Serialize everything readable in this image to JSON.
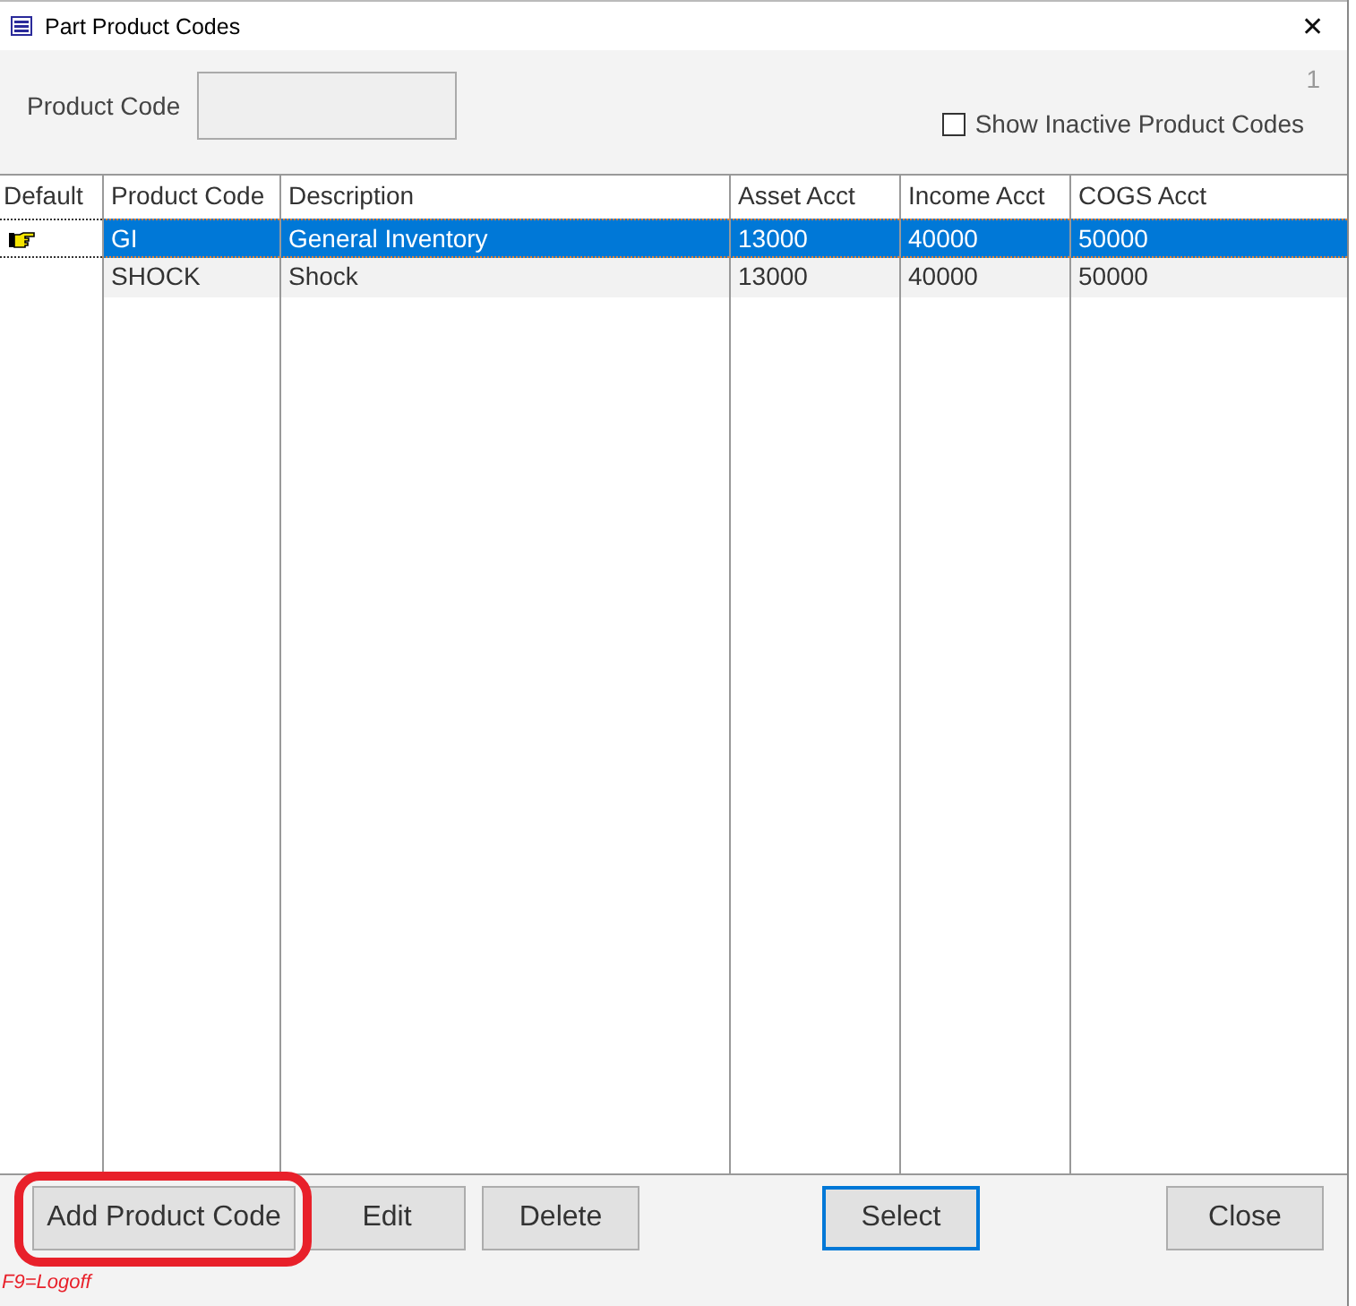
{
  "window": {
    "title": "Part Product Codes",
    "close": "✕"
  },
  "record_count": "1",
  "product_code": {
    "label": "Product Code"
  },
  "show_inactive": {
    "label": "Show Inactive Product Codes",
    "checked": false
  },
  "table": {
    "columns": [
      "Default",
      "Product Code",
      "Description",
      "Asset  Acct",
      "Income Acct",
      "COGS Acct"
    ],
    "rows": [
      {
        "default": true,
        "selected": true,
        "cells": [
          "",
          "GI",
          "General Inventory",
          "13000",
          "40000",
          "50000"
        ]
      },
      {
        "default": false,
        "selected": false,
        "cells": [
          "",
          "SHOCK",
          "Shock",
          "13000",
          "40000",
          "50000"
        ]
      }
    ]
  },
  "buttons": [
    {
      "label": "Add Product Code",
      "focused": false,
      "highlighted": true
    },
    {
      "label": "Edit",
      "focused": false,
      "highlighted": false
    },
    {
      "label": "Delete",
      "focused": false,
      "highlighted": false
    },
    {
      "label": "Select",
      "focused": true,
      "highlighted": false
    },
    {
      "label": "Close",
      "focused": false,
      "highlighted": false
    }
  ],
  "hint": "F9=Logoff"
}
